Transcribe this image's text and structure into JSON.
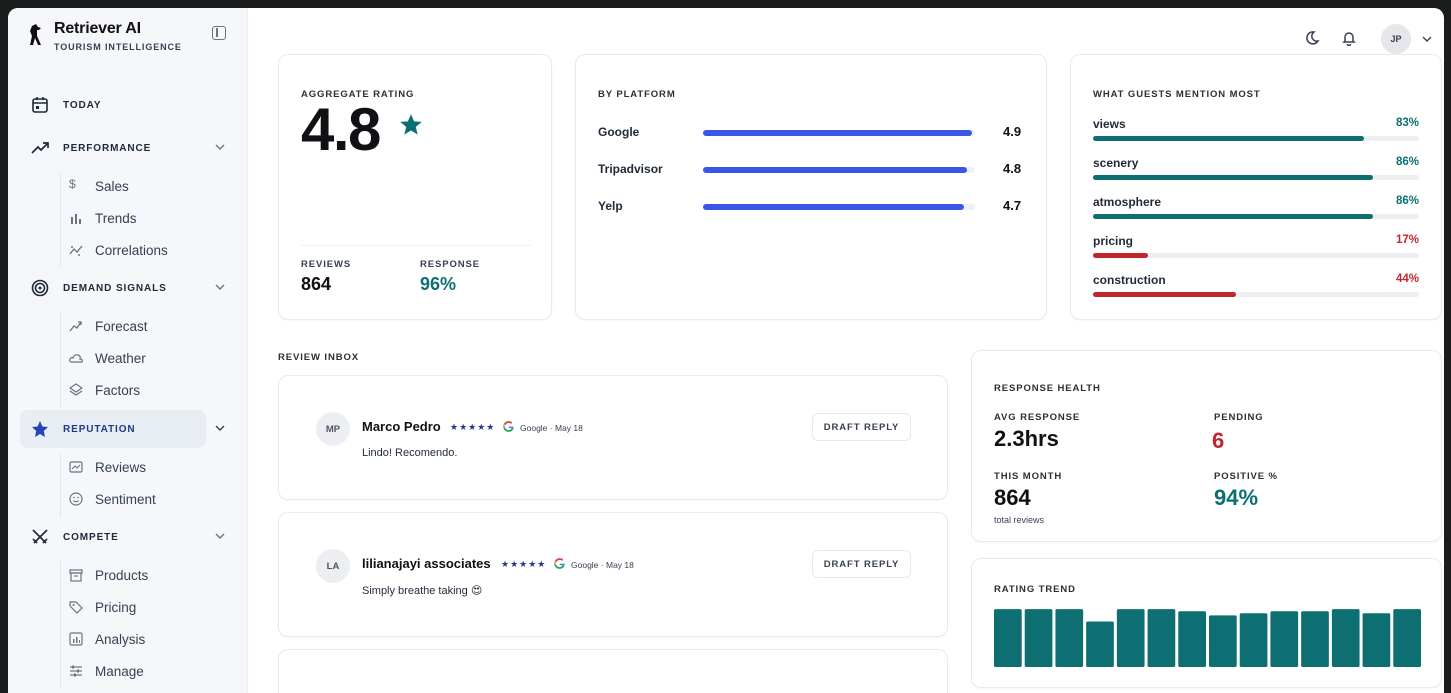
{
  "brand": {
    "name": "Retriever AI",
    "subtitle": "TOURISM INTELLIGENCE"
  },
  "sidebar": {
    "items": [
      {
        "label": "TODAY"
      },
      {
        "label": "PERFORMANCE",
        "children": [
          "Sales",
          "Trends",
          "Correlations"
        ]
      },
      {
        "label": "DEMAND SIGNALS",
        "children": [
          "Forecast",
          "Weather",
          "Factors"
        ]
      },
      {
        "label": "REPUTATION",
        "active": true,
        "children": [
          "Reviews",
          "Sentiment"
        ]
      },
      {
        "label": "COMPETE",
        "children": [
          "Products",
          "Pricing",
          "Analysis",
          "Manage"
        ]
      }
    ]
  },
  "topbar": {
    "avatar_initials": "JP"
  },
  "aggregate": {
    "title": "AGGREGATE RATING",
    "rating": "4.8",
    "reviews_label": "REVIEWS",
    "reviews_value": "864",
    "response_label": "RESPONSE",
    "response_value": "96%"
  },
  "platforms": {
    "title": "BY PLATFORM",
    "rows": [
      {
        "name": "Google",
        "value": "4.9",
        "fill": 0.99
      },
      {
        "name": "Tripadvisor",
        "value": "4.8",
        "fill": 0.97
      },
      {
        "name": "Yelp",
        "value": "4.7",
        "fill": 0.96
      }
    ]
  },
  "mentions": {
    "title": "WHAT GUESTS MENTION MOST",
    "rows": [
      {
        "name": "views",
        "pct": "83%",
        "fill": 0.83,
        "sentiment": "positive"
      },
      {
        "name": "scenery",
        "pct": "86%",
        "fill": 0.86,
        "sentiment": "positive"
      },
      {
        "name": "atmosphere",
        "pct": "86%",
        "fill": 0.86,
        "sentiment": "positive"
      },
      {
        "name": "pricing",
        "pct": "17%",
        "fill": 0.17,
        "sentiment": "negative"
      },
      {
        "name": "construction",
        "pct": "44%",
        "fill": 0.44,
        "sentiment": "negative"
      }
    ]
  },
  "inbox": {
    "title": "REVIEW INBOX",
    "reviews": [
      {
        "initials": "MP",
        "author": "Marco Pedro",
        "stars": "★★★★★",
        "platform": "Google",
        "date": "May 18",
        "text": "Lindo! Recomendo.",
        "action": "DRAFT REPLY"
      },
      {
        "initials": "LA",
        "author": "lilianajayi associates",
        "stars": "★★★★★",
        "platform": "Google",
        "date": "May 18",
        "text": "Simply breathe taking 😍",
        "action": "DRAFT REPLY"
      }
    ]
  },
  "health": {
    "title": "RESPONSE HEALTH",
    "avg_label": "AVG RESPONSE",
    "avg_value": "2.3hrs",
    "pending_label": "PENDING",
    "pending_value": "6",
    "month_label": "THIS MONTH",
    "month_value": "864",
    "month_sub": "total reviews",
    "positive_label": "POSITIVE %",
    "positive_value": "94%"
  },
  "trend": {
    "title": "RATING TREND",
    "chart_data": {
      "type": "bar",
      "values": [
        4.9,
        4.9,
        4.9,
        4.6,
        4.9,
        4.9,
        4.85,
        4.75,
        4.8,
        4.85,
        4.85,
        4.9,
        4.8,
        4.9
      ],
      "ylim": [
        3.5,
        5.0
      ],
      "color": "#0e6f73"
    }
  },
  "colors": {
    "accent_blue": "#3b55e6",
    "teal": "#0e6f73",
    "red": "#c2262d",
    "nav_active": "#1e3a8a"
  }
}
